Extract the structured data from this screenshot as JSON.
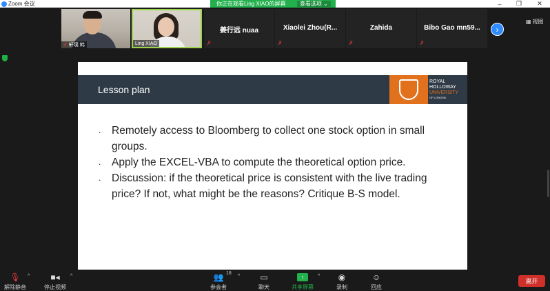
{
  "window": {
    "title": "Zoom 会议"
  },
  "banner": {
    "text": "你正在观看Ling XIAO的屏幕",
    "options_label": "查看选项"
  },
  "participants": {
    "video": [
      {
        "name": "轩璞 韩"
      },
      {
        "name": "Ling XIAO"
      }
    ],
    "named": [
      {
        "name": "姜行远 nuaa"
      },
      {
        "name": "Xiaolei Zhou(R..."
      },
      {
        "name": "Zahida"
      },
      {
        "name": "Bibo Gao mn59..."
      }
    ]
  },
  "view_button": {
    "label": "视图"
  },
  "slide": {
    "title": "Lesson plan",
    "logo": {
      "line1": "ROYAL",
      "line2": "HOLLOWAY",
      "line3": "UNIVERSITY",
      "line4": "OF LONDON"
    },
    "bullets": [
      "Remotely access to Bloomberg to collect one stock option in small groups.",
      "Apply the EXCEL-VBA to compute the theoretical option price.",
      "Discussion: if the theoretical price is consistent with the live trading price? If not, what might be the reasons? Critique B-S model."
    ]
  },
  "toolbar": {
    "unmute": "解除静音",
    "stop_video": "停止视频",
    "participants": "参会者",
    "participants_count": "18",
    "chat": "聊天",
    "share": "共享屏幕",
    "record": "录制",
    "reactions": "回应",
    "leave": "离开"
  },
  "colors": {
    "accent": "#2d8cff",
    "banner": "#23b14d",
    "leave": "#d0302a",
    "slide_header": "#2e3a46",
    "logo_orange": "#e2711d"
  }
}
